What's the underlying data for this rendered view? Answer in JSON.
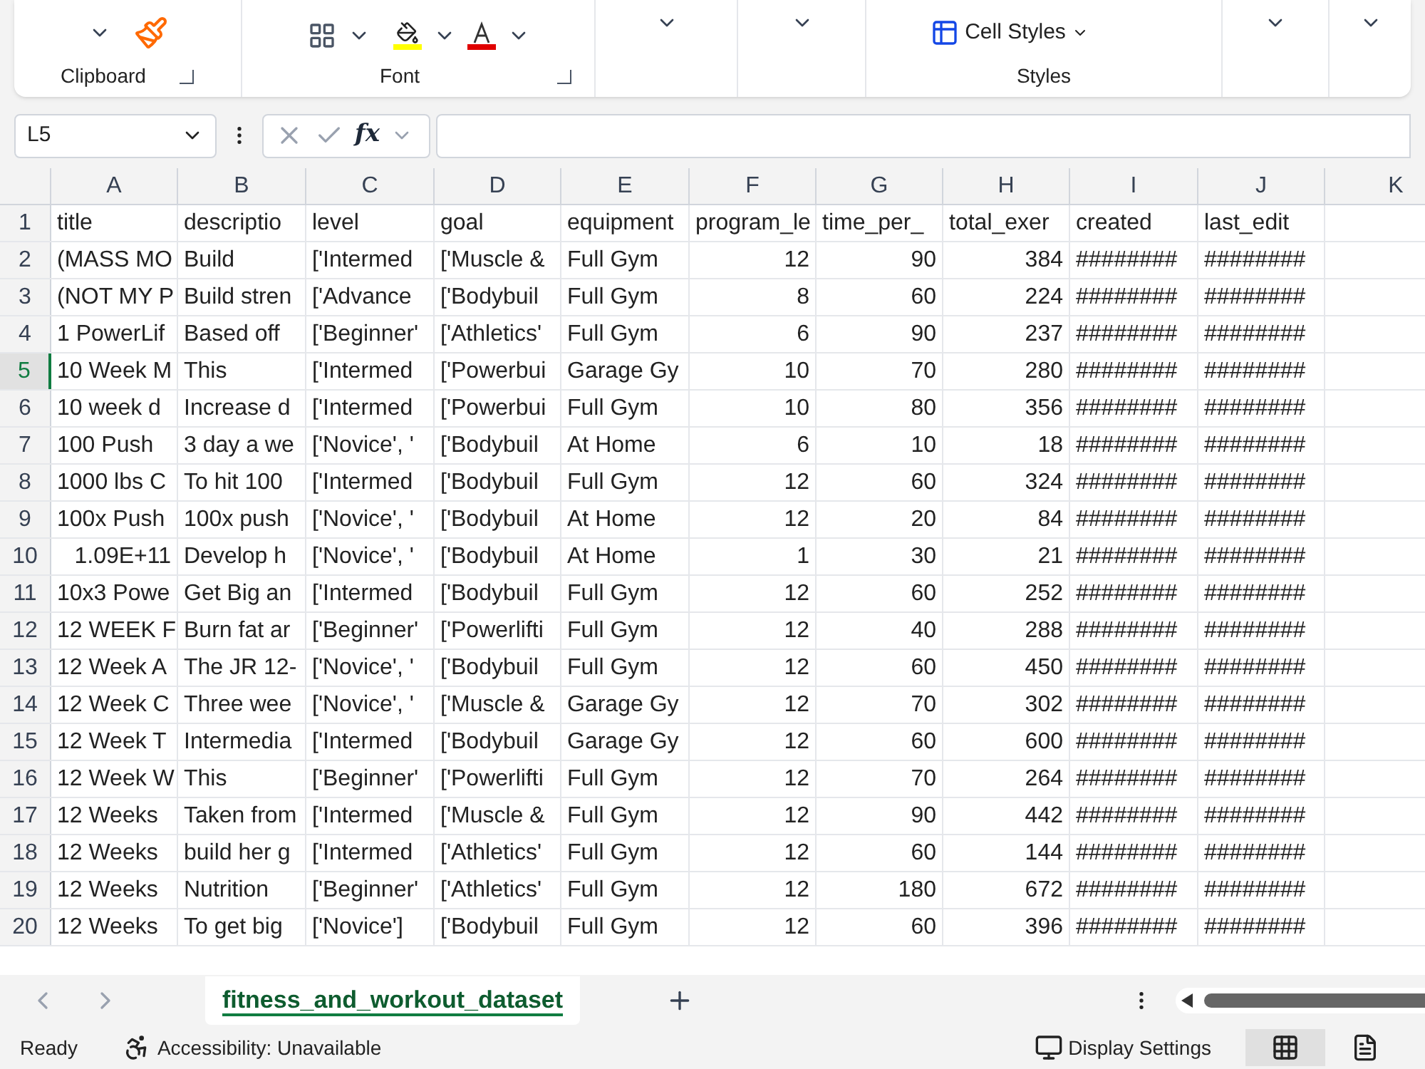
{
  "ribbon": {
    "groups": [
      {
        "label": "Clipboard"
      },
      {
        "label": "Font"
      },
      {
        "label": "Styles"
      }
    ],
    "cell_styles": "Cell Styles"
  },
  "formula_bar": {
    "name_box": "L5",
    "function_label": "fx"
  },
  "sheet": {
    "columns": [
      "A",
      "B",
      "C",
      "D",
      "E",
      "F",
      "G",
      "H",
      "I",
      "J",
      "K"
    ],
    "rows": [
      {
        "number": "1",
        "selected": false,
        "cells": [
          "title",
          "descriptio",
          "level",
          "goal",
          "equipment",
          "program_le",
          "time_per_",
          "total_exer",
          "created",
          "last_edit"
        ]
      },
      {
        "number": "2",
        "selected": false,
        "cells": [
          "(MASS MO",
          "Build",
          "['Intermed",
          "['Muscle &",
          "Full Gym",
          "12",
          "90",
          "384",
          "########",
          "########"
        ]
      },
      {
        "number": "3",
        "selected": false,
        "cells": [
          "(NOT MY P",
          "Build stren",
          "['Advance",
          "['Bodybuil",
          "Full Gym",
          "8",
          "60",
          "224",
          "########",
          "########"
        ]
      },
      {
        "number": "4",
        "selected": false,
        "cells": [
          "1 PowerLif",
          "Based off",
          "['Beginner'",
          "['Athletics'",
          "Full Gym",
          "6",
          "90",
          "237",
          "########",
          "########"
        ]
      },
      {
        "number": "5",
        "selected": true,
        "cells": [
          "10 Week M",
          "This",
          "['Intermed",
          "['Powerbui",
          "Garage Gy",
          "10",
          "70",
          "280",
          "########",
          "########"
        ]
      },
      {
        "number": "6",
        "selected": false,
        "cells": [
          "10 week d",
          "Increase d",
          "['Intermed",
          "['Powerbui",
          "Full Gym",
          "10",
          "80",
          "356",
          "########",
          "########"
        ]
      },
      {
        "number": "7",
        "selected": false,
        "cells": [
          "100 Push",
          "3 day a we",
          "['Novice', '",
          "['Bodybuil",
          "At Home",
          "6",
          "10",
          "18",
          "########",
          "########"
        ]
      },
      {
        "number": "8",
        "selected": false,
        "cells": [
          "1000 lbs C",
          "To hit 100",
          "['Intermed",
          "['Bodybuil",
          "Full Gym",
          "12",
          "60",
          "324",
          "########",
          "########"
        ]
      },
      {
        "number": "9",
        "selected": false,
        "cells": [
          "100x Push",
          "100x push",
          "['Novice', '",
          "['Bodybuil",
          "At Home",
          "12",
          "20",
          "84",
          "########",
          "########"
        ]
      },
      {
        "number": "10",
        "selected": false,
        "cells": [
          "1.09E+11",
          "Develop h",
          "['Novice', '",
          "['Bodybuil",
          "At Home",
          "1",
          "30",
          "21",
          "########",
          "########"
        ]
      },
      {
        "number": "11",
        "selected": false,
        "cells": [
          "10x3 Powe",
          "Get Big an",
          "['Intermed",
          "['Bodybuil",
          "Full Gym",
          "12",
          "60",
          "252",
          "########",
          "########"
        ]
      },
      {
        "number": "12",
        "selected": false,
        "cells": [
          "12 WEEK F",
          "Burn fat ar",
          "['Beginner'",
          "['Powerlifti",
          "Full Gym",
          "12",
          "40",
          "288",
          "########",
          "########"
        ]
      },
      {
        "number": "13",
        "selected": false,
        "cells": [
          "12 Week A",
          "The JR 12-",
          "['Novice', '",
          "['Bodybuil",
          "Full Gym",
          "12",
          "60",
          "450",
          "########",
          "########"
        ]
      },
      {
        "number": "14",
        "selected": false,
        "cells": [
          "12 Week C",
          "Three wee",
          "['Novice', '",
          "['Muscle &",
          "Garage Gy",
          "12",
          "70",
          "302",
          "########",
          "########"
        ]
      },
      {
        "number": "15",
        "selected": false,
        "cells": [
          "12 Week T",
          "Intermedia",
          "['Intermed",
          "['Bodybuil",
          "Garage Gy",
          "12",
          "60",
          "600",
          "########",
          "########"
        ]
      },
      {
        "number": "16",
        "selected": false,
        "cells": [
          "12 Week W",
          "This",
          "['Beginner'",
          "['Powerlifti",
          "Full Gym",
          "12",
          "70",
          "264",
          "########",
          "########"
        ]
      },
      {
        "number": "17",
        "selected": false,
        "cells": [
          "12 Weeks",
          "Taken from",
          "['Intermed",
          "['Muscle &",
          "Full Gym",
          "12",
          "90",
          "442",
          "########",
          "########"
        ]
      },
      {
        "number": "18",
        "selected": false,
        "cells": [
          "12 Weeks",
          "build her g",
          "['Intermed",
          "['Athletics'",
          "Full Gym",
          "12",
          "60",
          "144",
          "########",
          "########"
        ]
      },
      {
        "number": "19",
        "selected": false,
        "cells": [
          "12 Weeks",
          "Nutrition",
          "['Beginner'",
          "['Athletics'",
          "Full Gym",
          "12",
          "180",
          "672",
          "########",
          "########"
        ]
      },
      {
        "number": "20",
        "selected": false,
        "cells": [
          "12 Weeks",
          "To get big",
          "['Novice']",
          "['Bodybuil",
          "Full Gym",
          "12",
          "60",
          "396",
          "########",
          "########"
        ]
      }
    ]
  },
  "sheet_tabs": [
    {
      "label": "fitness_and_workout_dataset",
      "selected": true
    }
  ],
  "status_bar": {
    "status": "Ready",
    "accessibility": "Accessibility: Unavailable",
    "display_settings": "Display Settings",
    "views": [
      {
        "kind": "normal",
        "selected": true
      },
      {
        "kind": "page_layout",
        "selected": false
      }
    ]
  }
}
